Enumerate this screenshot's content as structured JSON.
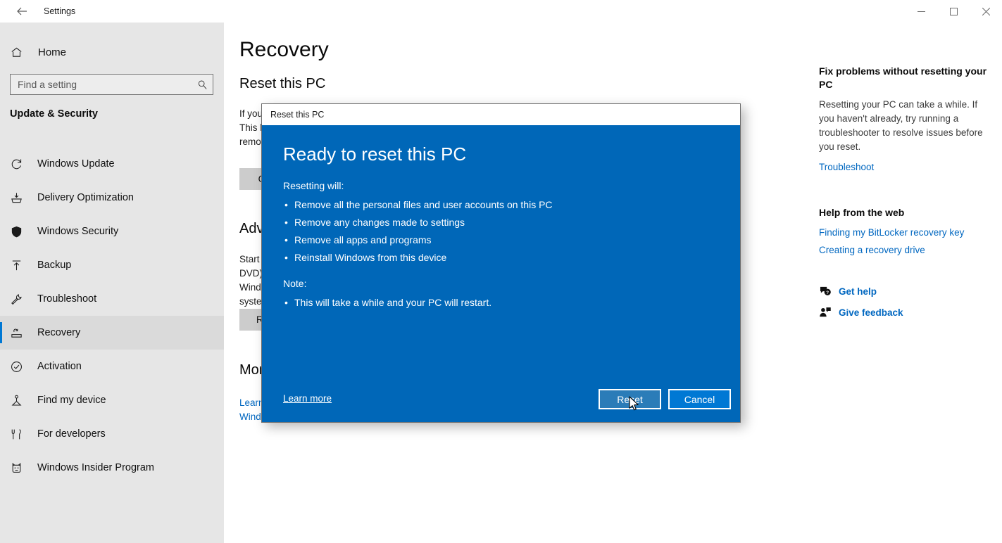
{
  "window": {
    "title": "Settings",
    "back_icon": "back-arrow-icon",
    "controls": {
      "minimize": "—",
      "maximize": "☐",
      "close": "✕"
    }
  },
  "sidebar": {
    "home_label": "Home",
    "home_icon": "home-icon",
    "search": {
      "placeholder": "Find a setting",
      "value": "",
      "icon": "search-icon"
    },
    "category": "Update & Security",
    "items": [
      {
        "label": "Windows Update",
        "icon": "refresh-icon",
        "selected": false
      },
      {
        "label": "Delivery Optimization",
        "icon": "delivery-icon",
        "selected": false
      },
      {
        "label": "Windows Security",
        "icon": "shield-icon",
        "selected": false
      },
      {
        "label": "Backup",
        "icon": "upload-arrow-icon",
        "selected": false
      },
      {
        "label": "Troubleshoot",
        "icon": "wrench-icon",
        "selected": false
      },
      {
        "label": "Recovery",
        "icon": "recovery-icon",
        "selected": true
      },
      {
        "label": "Activation",
        "icon": "check-circle-icon",
        "selected": false
      },
      {
        "label": "Find my device",
        "icon": "locate-device-icon",
        "selected": false
      },
      {
        "label": "For developers",
        "icon": "developer-tools-icon",
        "selected": false
      },
      {
        "label": "Windows Insider Program",
        "icon": "insider-cat-icon",
        "selected": false
      }
    ]
  },
  "main": {
    "page_title": "Recovery",
    "sections": [
      {
        "heading": "Reset this PC",
        "body": "If your PC isn't running well, resetting it might help. This lets you choose to keep your personal files or remove them, and then reinstalls Windows.",
        "button": "Get started"
      },
      {
        "heading": "Advanced startup",
        "body": "Start up from a device or disc (such as a USB drive or DVD), change your PC's firmware settings, change Windows startup settings, or restore Windows from a system image. This will restart your PC.",
        "button": "Restart now"
      },
      {
        "heading": "More recovery options",
        "link": "Learn how to start fresh with a clean installation of Windows"
      }
    ]
  },
  "right_panel": {
    "fix_heading": "Fix problems without resetting your PC",
    "fix_body": "Resetting your PC can take a while. If you haven't already, try running a troubleshooter to resolve issues before you reset.",
    "fix_link": "Troubleshoot",
    "web_heading": "Help from the web",
    "web_links": [
      "Finding my BitLocker recovery key",
      "Creating a recovery drive"
    ],
    "actions": [
      {
        "label": "Get help",
        "icon": "question-bubble-icon"
      },
      {
        "label": "Give feedback",
        "icon": "feedback-person-icon"
      }
    ]
  },
  "dialog": {
    "titlebar": "Reset this PC",
    "heading": "Ready to reset this PC",
    "lead": "Resetting will:",
    "bullets": [
      "Remove all the personal files and user accounts on this PC",
      "Remove any changes made to settings",
      "Remove all apps and programs",
      "Reinstall Windows from this device"
    ],
    "note_label": "Note:",
    "note_bullets": [
      "This will take a while and your PC will restart."
    ],
    "learn_more": "Learn more",
    "reset_button": "Reset",
    "cancel_button": "Cancel"
  },
  "colors": {
    "accent": "#0078d4",
    "dialog_bg": "#0067b8",
    "link": "#0067c0",
    "sidebar_bg": "#e6e6e6"
  }
}
